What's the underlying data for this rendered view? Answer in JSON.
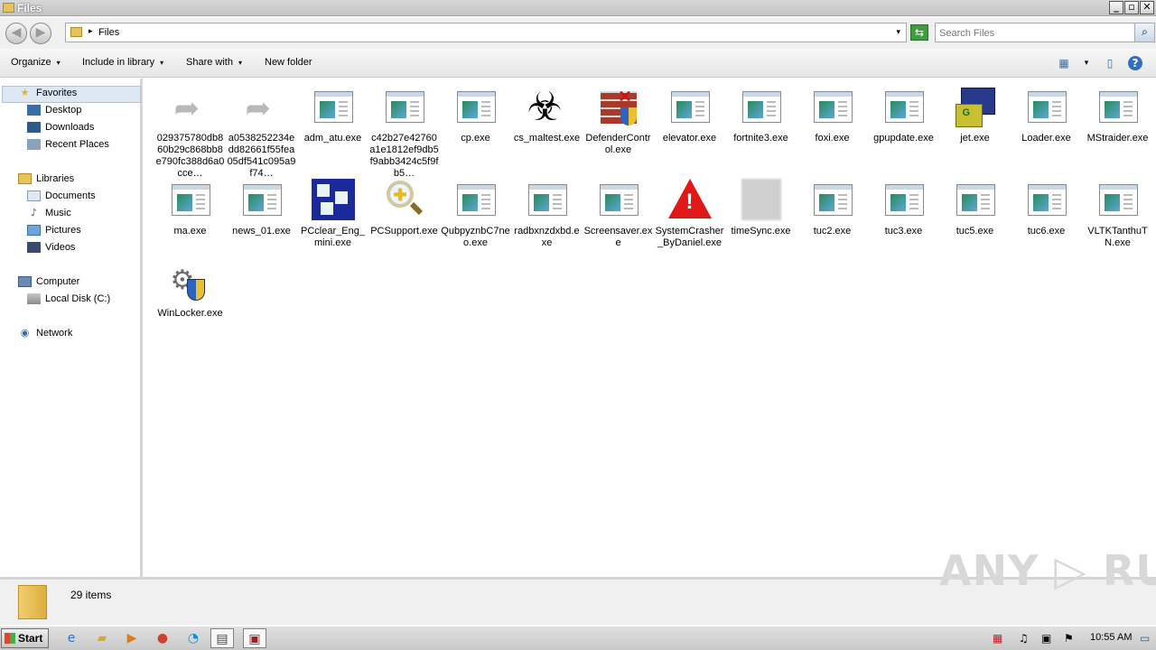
{
  "window": {
    "title": "Files",
    "minimize": "_",
    "restore": "▫",
    "close": "✕"
  },
  "address": {
    "path": "Files",
    "separator": "▸",
    "dropdown": "▾",
    "back": "◀",
    "forward": "▶",
    "refresh": "⇆"
  },
  "search": {
    "placeholder": "Search Files",
    "icon": "search-icon",
    "glyph": "⌕"
  },
  "toolbar": {
    "organize": "Organize",
    "include_library": "Include in library",
    "share_with": "Share with",
    "new_folder": "New folder",
    "caret": "▾"
  },
  "nav": {
    "favorites": "Favorites",
    "desktop": "Desktop",
    "downloads": "Downloads",
    "recent_places": "Recent Places",
    "libraries": "Libraries",
    "documents": "Documents",
    "music": "Music",
    "pictures": "Pictures",
    "videos": "Videos",
    "computer": "Computer",
    "local_disk": "Local Disk (C:)",
    "network": "Network"
  },
  "files": [
    {
      "name": "029375780db860b29c868bb8e790fc388d6a0cce…",
      "icon": "shortcut"
    },
    {
      "name": "a0538252234edd82661f55fea05df541c095a9f74…",
      "icon": "shortcut"
    },
    {
      "name": "adm_atu.exe",
      "icon": "window"
    },
    {
      "name": "c42b27e42760a1e1812ef9db5f9abb3424c5f9fb5…",
      "icon": "window"
    },
    {
      "name": "cp.exe",
      "icon": "window"
    },
    {
      "name": "cs_maltest.exe",
      "icon": "biohazard"
    },
    {
      "name": "DefenderControl.exe",
      "icon": "firewall"
    },
    {
      "name": "elevator.exe",
      "icon": "window"
    },
    {
      "name": "fortnite3.exe",
      "icon": "window"
    },
    {
      "name": "foxi.exe",
      "icon": "window"
    },
    {
      "name": "gpupdate.exe",
      "icon": "window"
    },
    {
      "name": "jet.exe",
      "icon": "installer"
    },
    {
      "name": "Loader.exe",
      "icon": "window"
    },
    {
      "name": "MStraider.exe",
      "icon": "window"
    },
    {
      "name": "ma.exe",
      "icon": "window"
    },
    {
      "name": "news_01.exe",
      "icon": "window"
    },
    {
      "name": "PCclear_Eng_mini.exe",
      "icon": "cubes"
    },
    {
      "name": "PCSupport.exe",
      "icon": "magnifier"
    },
    {
      "name": "QubpyznbC7neo.exe",
      "icon": "window"
    },
    {
      "name": "radbxnzdxbd.exe",
      "icon": "window"
    },
    {
      "name": "Screensaver.exe",
      "icon": "window"
    },
    {
      "name": "SystemCrasher_ByDaniel.exe",
      "icon": "warning"
    },
    {
      "name": "timeSync.exe",
      "icon": "blurred"
    },
    {
      "name": "tuc2.exe",
      "icon": "window"
    },
    {
      "name": "tuc3.exe",
      "icon": "window"
    },
    {
      "name": "tuc5.exe",
      "icon": "window"
    },
    {
      "name": "tuc6.exe",
      "icon": "window"
    },
    {
      "name": "VLTKTanthuTN.exe",
      "icon": "window"
    },
    {
      "name": "WinLocker.exe",
      "icon": "gears-shield"
    }
  ],
  "status": {
    "count": "29 items"
  },
  "watermark": "ANY ▷ RUN",
  "taskbar": {
    "start": "Start",
    "clock": "10:55 AM"
  }
}
